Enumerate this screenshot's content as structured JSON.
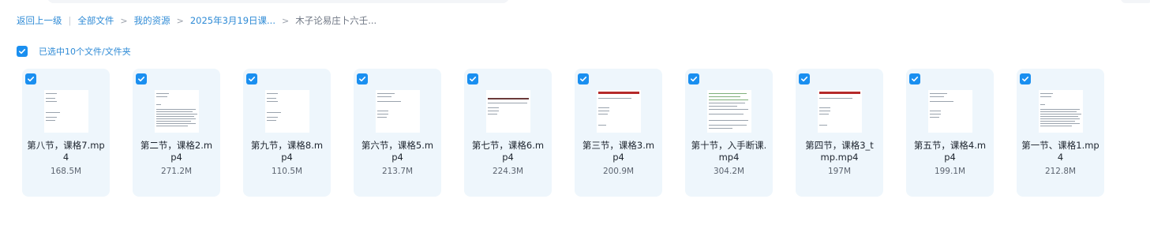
{
  "breadcrumb": {
    "back": "返回上一级",
    "items": [
      "全部文件",
      "我的资源",
      "2025年3月19日课...",
      "木子论易庄卜六壬..."
    ]
  },
  "selection": {
    "label": "已选中10个文件/文件夹",
    "checked": true
  },
  "files": [
    {
      "name_line1": "第八节，课格7.mp",
      "name_line2": "4",
      "size": "168.5M",
      "thumb": "text-sparse",
      "checked": true
    },
    {
      "name_line1": "第二节，课格2.m",
      "name_line2": "p4",
      "size": "271.2M",
      "thumb": "text-dense",
      "checked": true
    },
    {
      "name_line1": "第九节，课格8.m",
      "name_line2": "p4",
      "size": "110.5M",
      "thumb": "text-sparse",
      "checked": true
    },
    {
      "name_line1": "第六节，课格5.m",
      "name_line2": "p4",
      "size": "213.7M",
      "thumb": "text-medium",
      "checked": true
    },
    {
      "name_line1": "第七节，课格6.m",
      "name_line2": "p4",
      "size": "224.3M",
      "thumb": "header-dark",
      "checked": true
    },
    {
      "name_line1": "第三节，课格3.m",
      "name_line2": "p4",
      "size": "200.9M",
      "thumb": "header-red",
      "checked": true
    },
    {
      "name_line1": "第十节，入手断课.",
      "name_line2": "mp4",
      "size": "304.2M",
      "thumb": "text-green",
      "checked": true
    },
    {
      "name_line1": "第四节，课格3_t",
      "name_line2": "mp.mp4",
      "size": "197M",
      "thumb": "header-red",
      "checked": true
    },
    {
      "name_line1": "第五节，课格4.m",
      "name_line2": "p4",
      "size": "199.1M",
      "thumb": "text-medium",
      "checked": true
    },
    {
      "name_line1": "第一节、课格1.mp",
      "name_line2": "4",
      "size": "212.8M",
      "thumb": "text-dense",
      "checked": true
    }
  ],
  "colors": {
    "accent": "#1a8ff0",
    "link": "#2f8bd6",
    "card_bg": "#eef6fc"
  },
  "icons": {
    "checkbox": "check-icon",
    "separator": "chevron-right-icon"
  }
}
